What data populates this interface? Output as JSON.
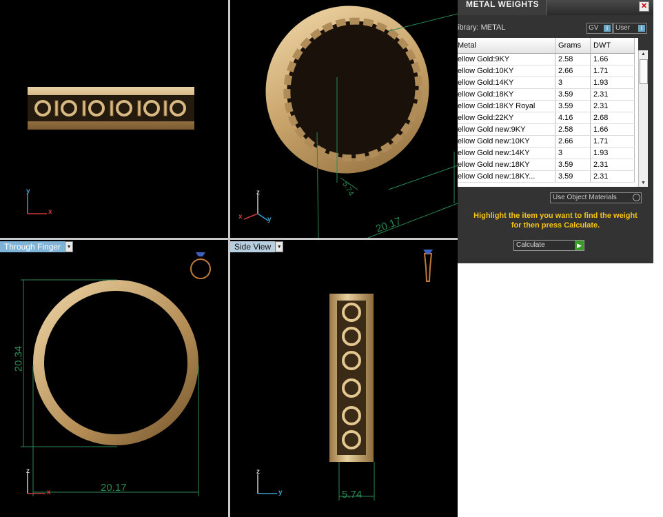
{
  "viewports": {
    "front": {
      "label": "Through Finger",
      "dim_height": "20.34",
      "dim_width": "20.17"
    },
    "side": {
      "label": "Side View",
      "dim_width": "5.74"
    },
    "perspective": {
      "dim_width": "5.74",
      "dim_length": "20.17"
    }
  },
  "axes": {
    "x": "x",
    "y": "y",
    "z": "z"
  },
  "panel": {
    "title": "METAL WEIGHTS",
    "close_label": "✕",
    "library": "ibrary: METAL",
    "toggle_gv": "GV",
    "toggle_user": "User",
    "columns": [
      "Metal",
      "Grams",
      "DWT"
    ],
    "rows": [
      [
        "ellow Gold:9KY",
        "2.58",
        "1.66"
      ],
      [
        "ellow Gold:10KY",
        "2.66",
        "1.71"
      ],
      [
        "ellow Gold:14KY",
        "3",
        "1.93"
      ],
      [
        "ellow Gold:18KY",
        "3.59",
        "2.31"
      ],
      [
        "ellow Gold:18KY Royal",
        "3.59",
        "2.31"
      ],
      [
        "ellow Gold:22KY",
        "4.16",
        "2.68"
      ],
      [
        "ellow Gold new:9KY",
        "2.58",
        "1.66"
      ],
      [
        "ellow Gold new:10KY",
        "2.66",
        "1.71"
      ],
      [
        "ellow Gold new:14KY",
        "3",
        "1.93"
      ],
      [
        "ellow Gold new:18KY",
        "3.59",
        "2.31"
      ],
      [
        "ellow Gold new:18KY...",
        "3.59",
        "2.31"
      ]
    ],
    "use_object_materials": "Use Object Materials",
    "hint_line1": "Highlight the item you want to find the weight",
    "hint_line2": "for then press Calculate.",
    "calculate_label": "Calculate"
  }
}
